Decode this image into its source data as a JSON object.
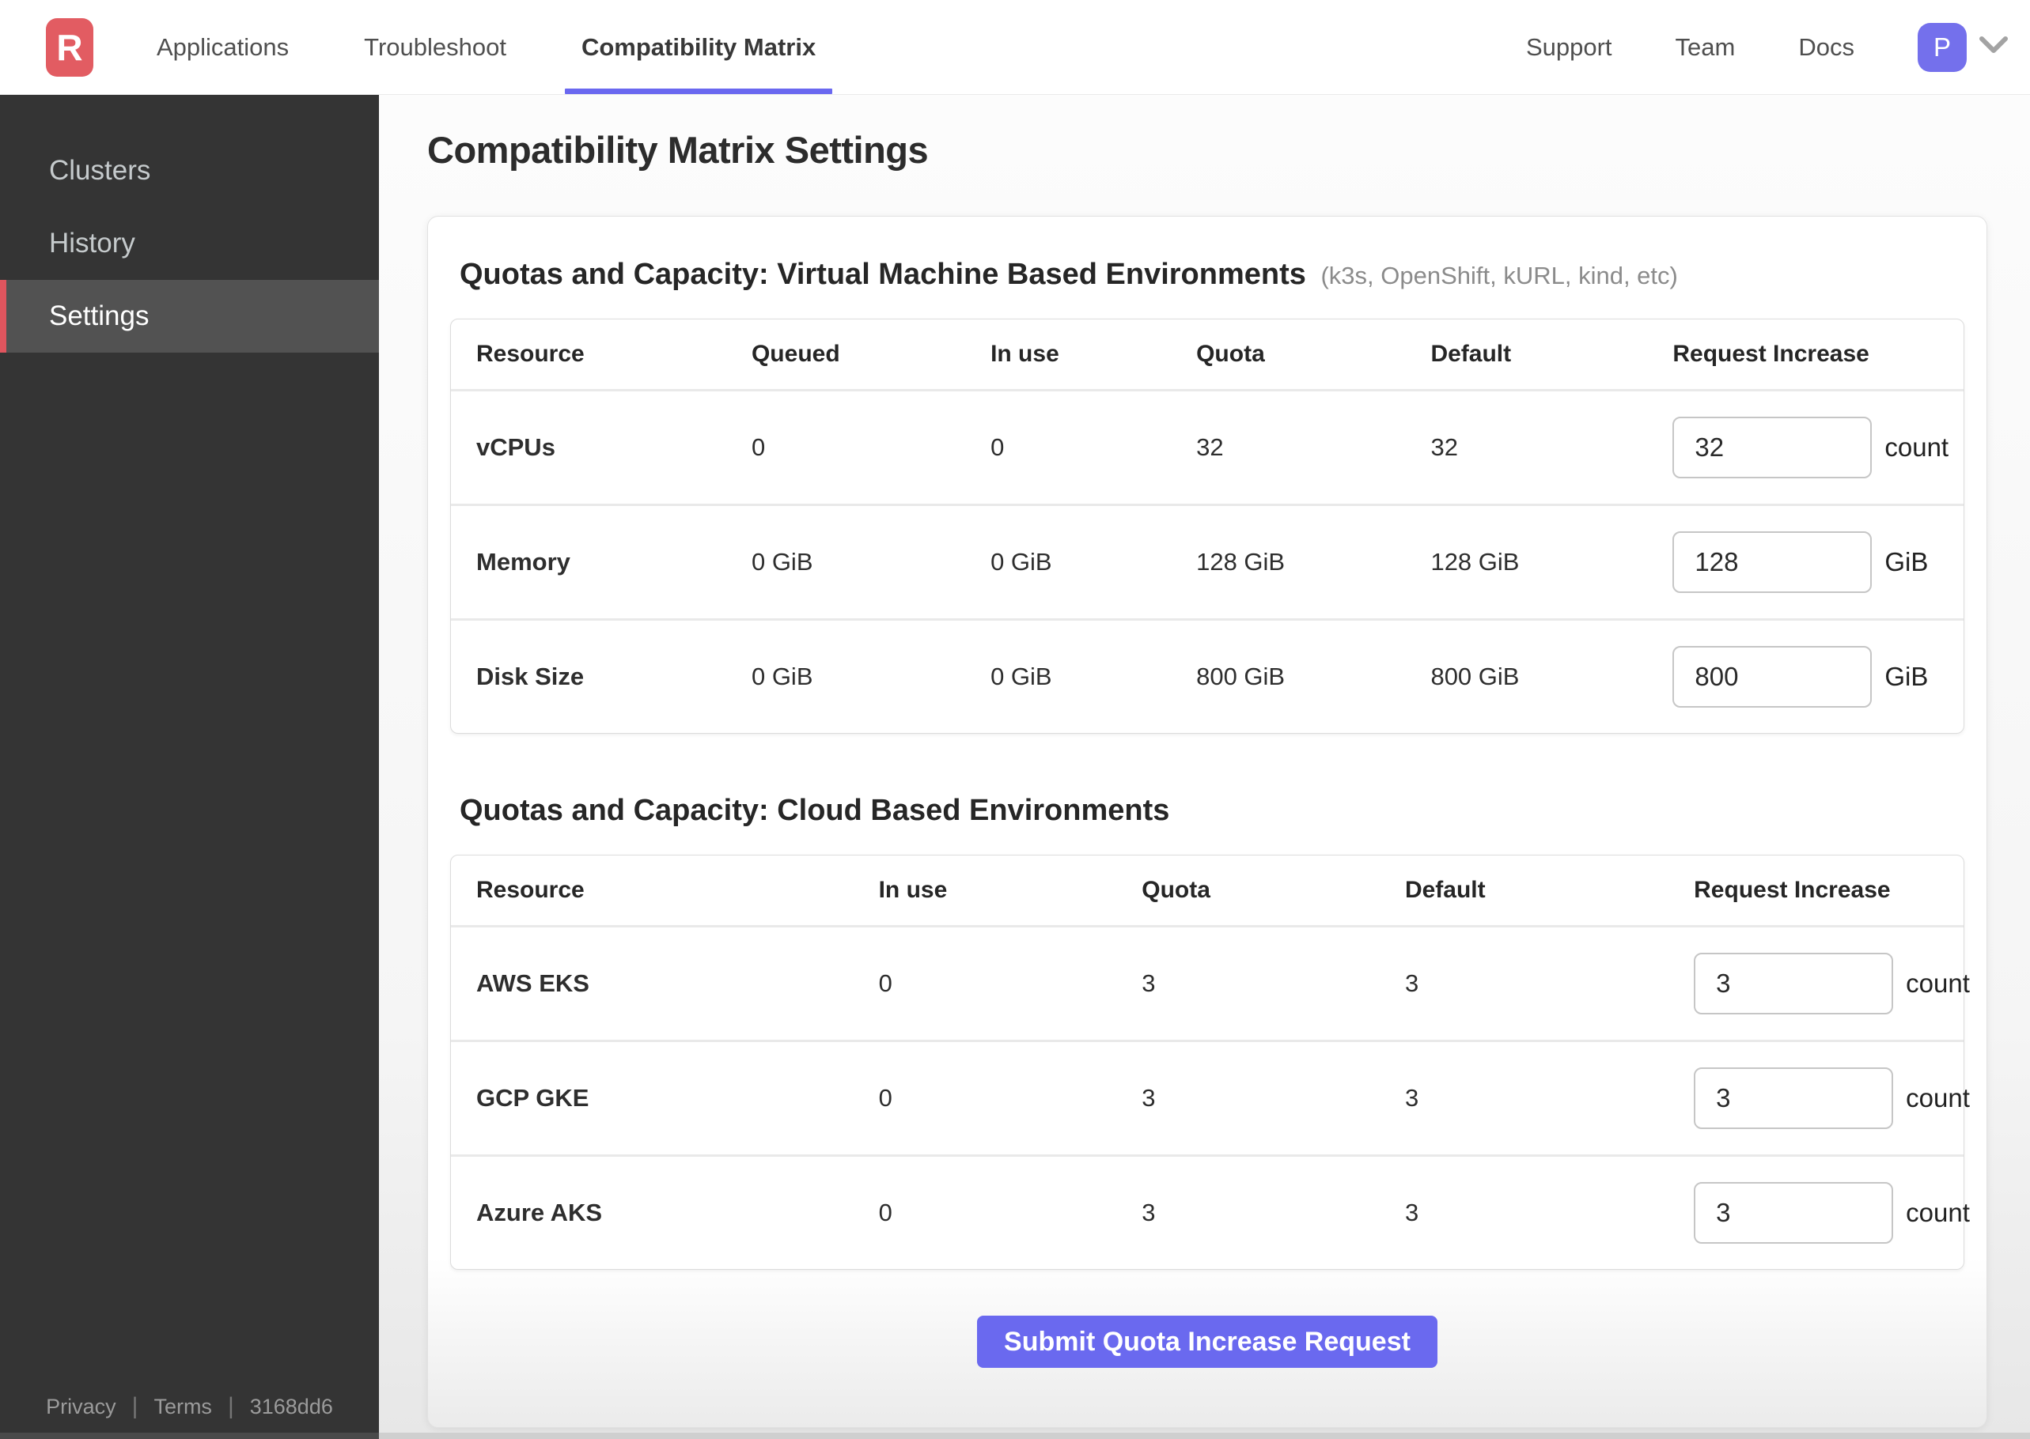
{
  "nav": {
    "logo_letter": "R",
    "tabs": [
      {
        "label": "Applications",
        "active": false
      },
      {
        "label": "Troubleshoot",
        "active": false
      },
      {
        "label": "Compatibility Matrix",
        "active": true
      }
    ],
    "links": [
      "Support",
      "Team",
      "Docs"
    ],
    "avatar_initial": "P"
  },
  "sidebar": {
    "items": [
      {
        "label": "Clusters",
        "active": false
      },
      {
        "label": "History",
        "active": false
      },
      {
        "label": "Settings",
        "active": true
      }
    ],
    "footer": {
      "privacy": "Privacy",
      "terms": "Terms",
      "build": "3168dd6"
    }
  },
  "page": {
    "title": "Compatibility Matrix Settings",
    "vm_section": {
      "heading": "Quotas and Capacity: Virtual Machine Based Environments",
      "heading_note": "(k3s, OpenShift, kURL, kind, etc)",
      "columns": [
        "Resource",
        "Queued",
        "In use",
        "Quota",
        "Default",
        "Request Increase"
      ],
      "rows": [
        {
          "resource": "vCPUs",
          "queued": "0",
          "in_use": "0",
          "quota": "32",
          "default": "32",
          "request_value": "32",
          "unit": "count"
        },
        {
          "resource": "Memory",
          "queued": "0 GiB",
          "in_use": "0 GiB",
          "quota": "128 GiB",
          "default": "128 GiB",
          "request_value": "128",
          "unit": "GiB"
        },
        {
          "resource": "Disk Size",
          "queued": "0 GiB",
          "in_use": "0 GiB",
          "quota": "800 GiB",
          "default": "800 GiB",
          "request_value": "800",
          "unit": "GiB"
        }
      ]
    },
    "cloud_section": {
      "heading": "Quotas and Capacity: Cloud Based Environments",
      "columns": [
        "Resource",
        "In use",
        "Quota",
        "Default",
        "Request Increase"
      ],
      "rows": [
        {
          "resource": "AWS EKS",
          "in_use": "0",
          "quota": "3",
          "default": "3",
          "request_value": "3",
          "unit": "count"
        },
        {
          "resource": "GCP GKE",
          "in_use": "0",
          "quota": "3",
          "default": "3",
          "request_value": "3",
          "unit": "count"
        },
        {
          "resource": "Azure AKS",
          "in_use": "0",
          "quota": "3",
          "default": "3",
          "request_value": "3",
          "unit": "count"
        }
      ]
    },
    "submit_label": "Submit Quota Increase Request"
  },
  "colors": {
    "brand_red": "#e25c62",
    "accent_indigo": "#6a68f0",
    "button_indigo": "#6a69ef",
    "avatar_purple": "#7470ec",
    "sidebar_bg": "#343434",
    "sidebar_active_bg": "#525252",
    "sidebar_active_accent": "#e0555e"
  }
}
